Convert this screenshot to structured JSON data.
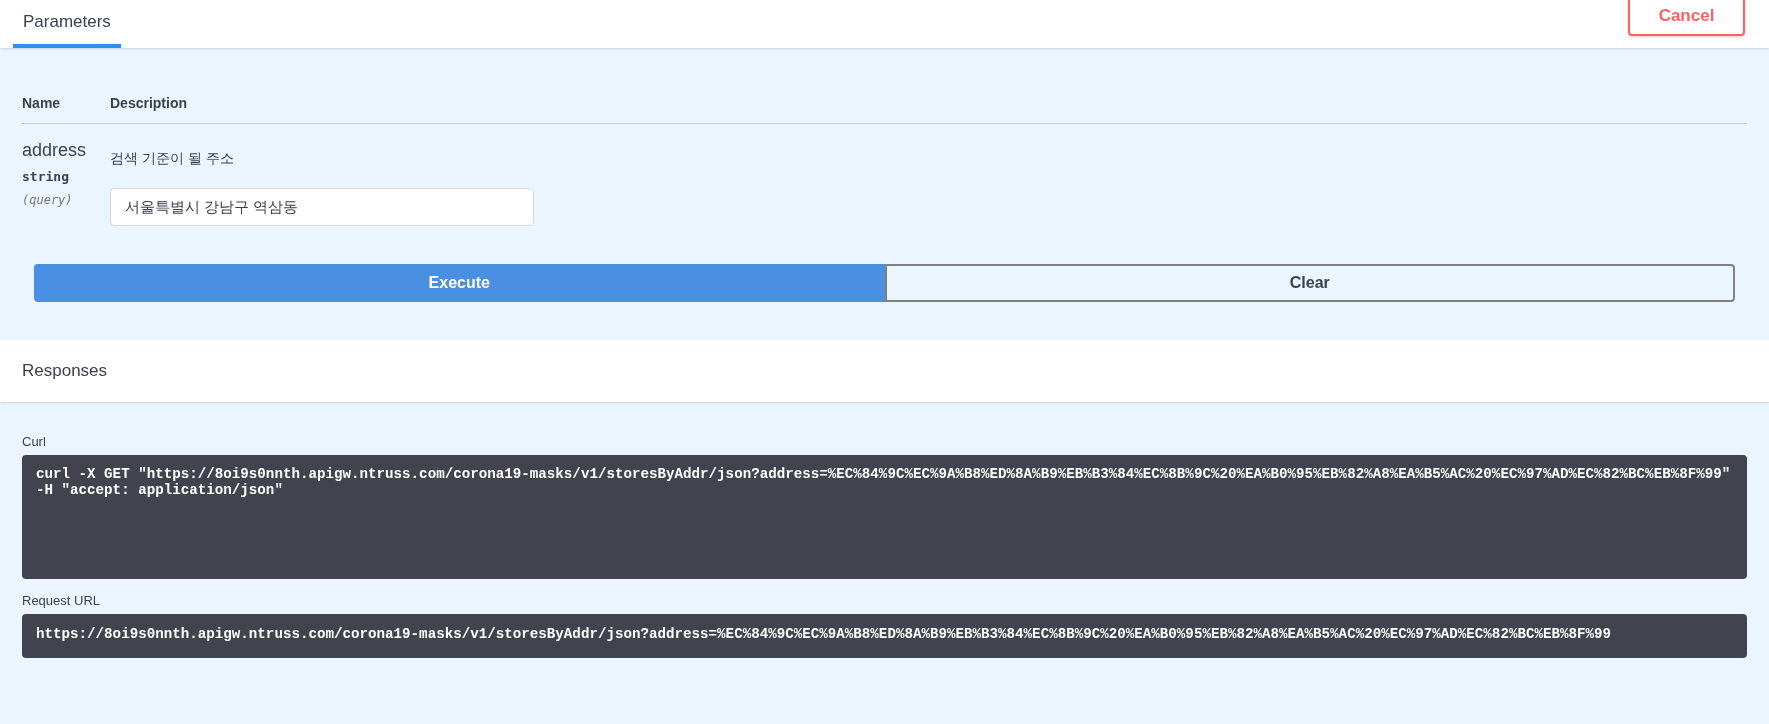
{
  "tabs": [
    {
      "label": "Parameters",
      "selected": true
    }
  ],
  "cancel_button": "Cancel",
  "parameters_table": {
    "columns": [
      "Name",
      "Description"
    ],
    "rows": [
      {
        "name": "address",
        "type": "string",
        "location": "(query)",
        "description": "검색 기준이 될 주소",
        "value": "서울특별시 강남구 역삼동"
      }
    ]
  },
  "execute_button": "Execute",
  "clear_button": "Clear",
  "responses_title": "Responses",
  "curl": {
    "label": "Curl",
    "code": "curl -X GET \"https://8oi9s0nnth.apigw.ntruss.com/corona19-masks/v1/storesByAddr/json?address=%EC%84%9C%EC%9A%B8%ED%8A%B9%EB%B3%84%EC%8B%9C%20%EA%B0%95%EB%82%A8%EA%B5%AC%20%EC%97%AD%EC%82%BC%EB%8F%99\" -H \"accept: application/json\""
  },
  "request_url": {
    "label": "Request URL",
    "code": "https://8oi9s0nnth.apigw.ntruss.com/corona19-masks/v1/storesByAddr/json?address=%EC%84%9C%EC%9A%B8%ED%8A%B9%EB%B3%84%EC%8B%9C%20%EA%B0%95%EB%82%A8%EA%B5%AC%20%EC%97%AD%EC%82%BC%EB%8F%99"
  }
}
